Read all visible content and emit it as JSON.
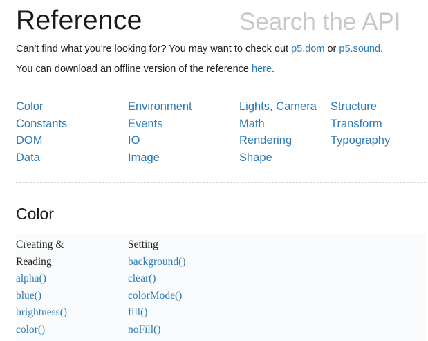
{
  "header": {
    "title": "Reference",
    "search_placeholder": "Search the API"
  },
  "intro": {
    "line1_prefix": "Can't find what you're looking for? You may want to check out ",
    "line1_link1": "p5.dom",
    "line1_middle": " or ",
    "line1_link2": "p5.sound",
    "line1_suffix": ".",
    "line2_prefix": "You can download an offline version of the reference ",
    "line2_link": "here",
    "line2_suffix": "."
  },
  "categories": {
    "columns": [
      [
        "Color",
        "Constants",
        "DOM",
        "Data"
      ],
      [
        "Environment",
        "Events",
        "IO",
        "Image"
      ],
      [
        "Lights, Camera",
        "Math",
        "Rendering",
        "Shape"
      ],
      [
        "Structure",
        "Transform",
        "Typography"
      ]
    ]
  },
  "section": {
    "heading": "Color",
    "columns": [
      {
        "heading_lines": [
          "Creating &",
          "Reading"
        ],
        "items": [
          "alpha()",
          "blue()",
          "brightness()",
          "color()"
        ]
      },
      {
        "heading_lines": [
          "Setting"
        ],
        "items": [
          "background()",
          "clear()",
          "colorMode()",
          "fill()",
          "noFill()"
        ]
      }
    ]
  },
  "colors": {
    "link": "#2d7bb6",
    "text": "#222222",
    "placeholder": "#c8c8c8"
  }
}
